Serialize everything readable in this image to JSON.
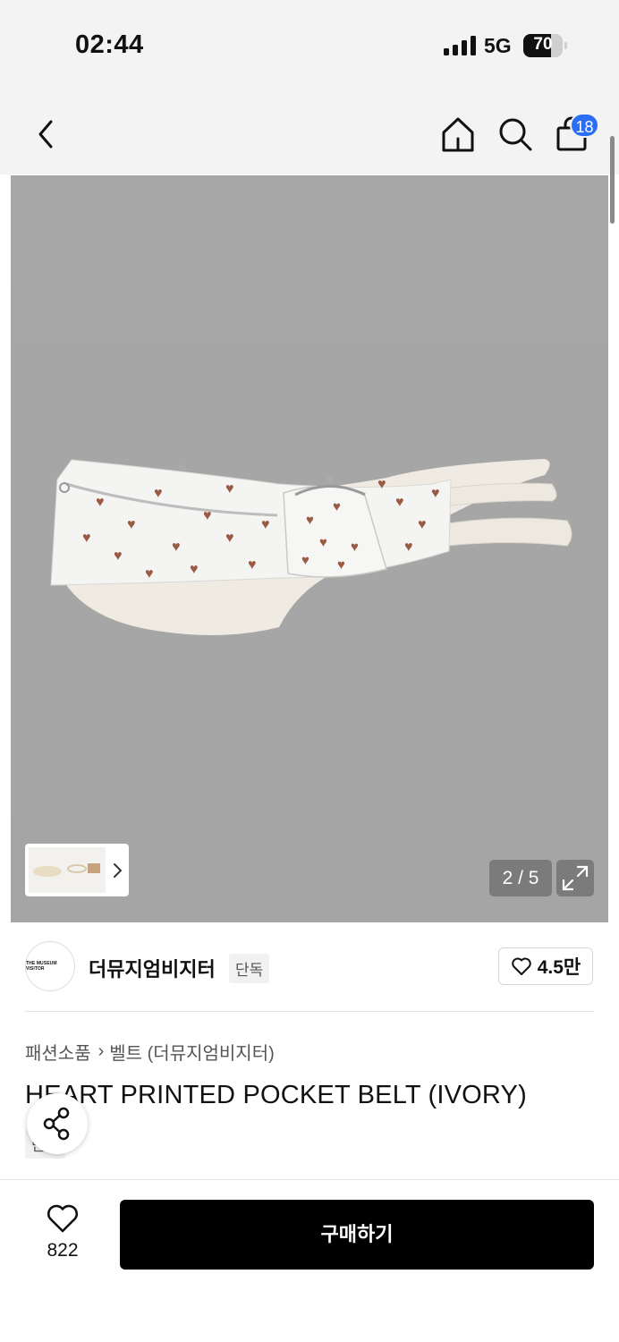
{
  "status_bar": {
    "time": "02:44",
    "network": "5G",
    "battery": "70"
  },
  "nav": {
    "cart_badge": "18",
    "icons": [
      "back-arrow-icon",
      "home-icon",
      "search-icon",
      "shopping-bag-icon"
    ]
  },
  "gallery": {
    "counter": "2 / 5",
    "current": 2,
    "total": 5
  },
  "brand": {
    "logo_text": "THE MUSEUM VISITOR",
    "name": "더뮤지엄비지터",
    "tag": "단독",
    "likes": "4.5만"
  },
  "product": {
    "breadcrumb": [
      "패션소품",
      "벨트 (더뮤지엄비지터)"
    ],
    "title": "HEART PRINTED POCKET BELT (IVORY)",
    "tag": "단독"
  },
  "bottom_bar": {
    "wish_count": "822",
    "buy_label": "구매하기"
  },
  "colors": {
    "accent_badge": "#2a6ef5",
    "buy_button": "#000000",
    "image_bg": "#a7a7a7"
  }
}
